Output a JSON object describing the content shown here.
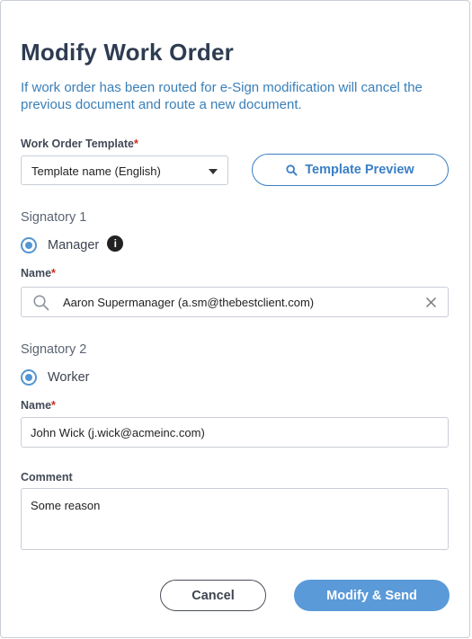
{
  "dialog": {
    "title": "Modify Work Order",
    "description": "If work order has been routed for e-Sign modification will cancel the previous document and route a new document."
  },
  "template": {
    "label": "Work Order Template",
    "required_mark": "*",
    "selected": "Template name (English)",
    "preview_button": "Template Preview"
  },
  "signatory1": {
    "heading": "Signatory 1",
    "role": "Manager",
    "info_icon": "info-icon",
    "name_label": "Name",
    "required_mark": "*",
    "name_value": "Aaron Supermanager (a.sm@thebestclient.com)"
  },
  "signatory2": {
    "heading": "Signatory 2",
    "role": "Worker",
    "name_label": "Name",
    "required_mark": "*",
    "name_value": "John Wick (j.wick@acmeinc.com)"
  },
  "comment": {
    "label": "Comment",
    "value": "Some reason"
  },
  "actions": {
    "cancel": "Cancel",
    "submit": "Modify & Send"
  },
  "colors": {
    "accent": "#3a7fc4",
    "primary_button": "#5b9ad8",
    "required": "#d0281e",
    "title": "#2e3c52",
    "description": "#3a7fb8"
  }
}
